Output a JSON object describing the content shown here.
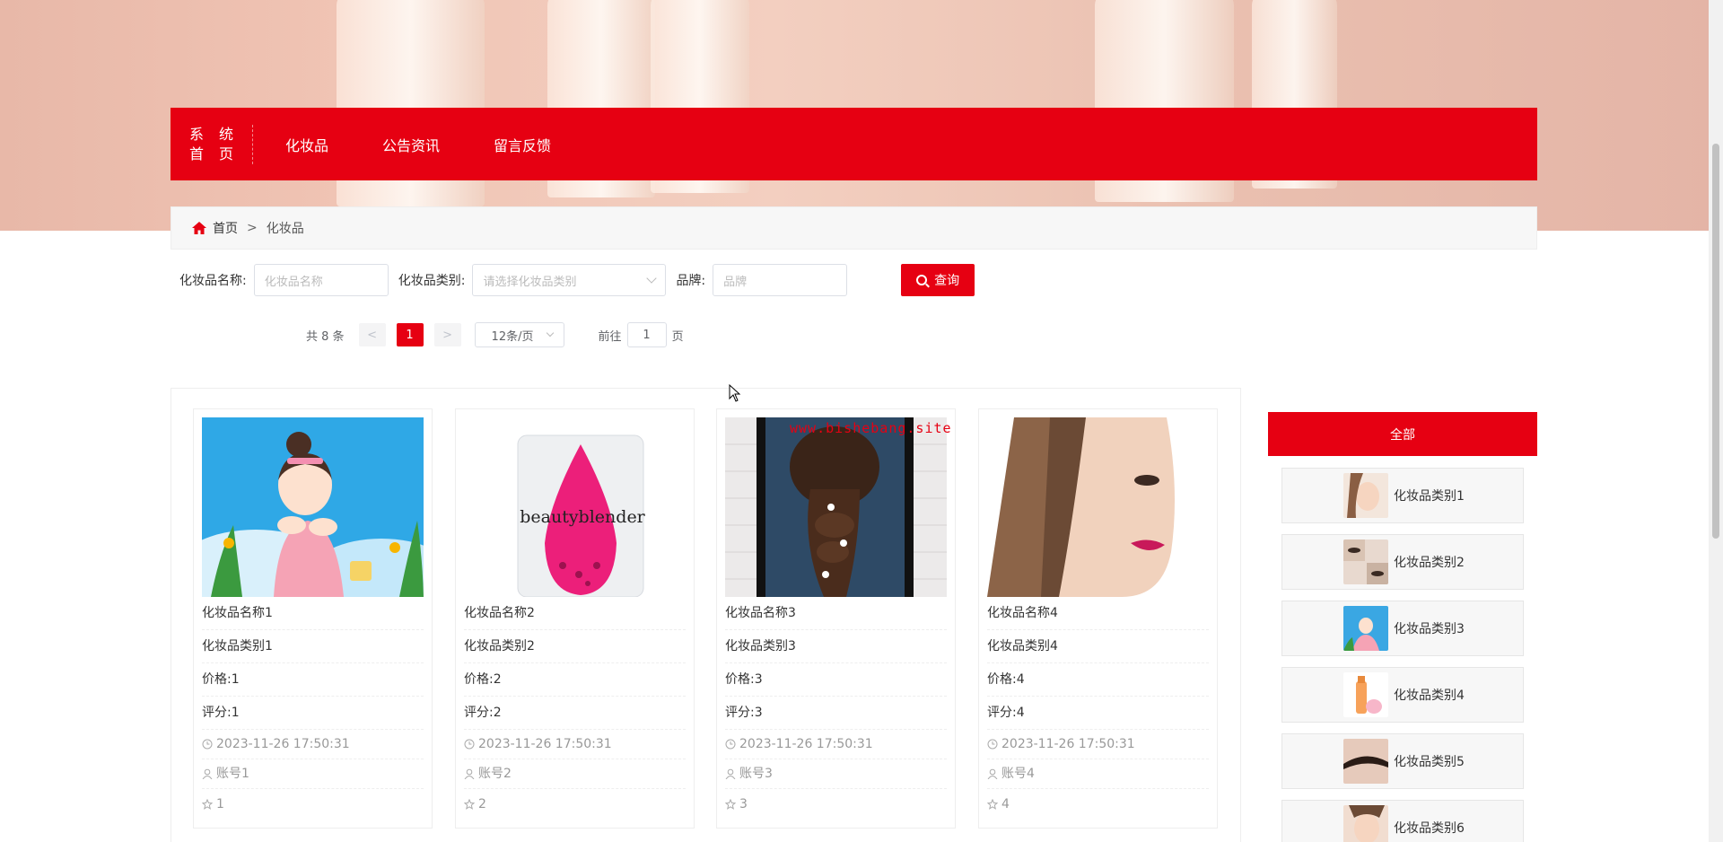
{
  "nav": {
    "home_line1": "系 统",
    "home_line2": "首 页",
    "items": [
      {
        "label": "化妆品"
      },
      {
        "label": "公告资讯"
      },
      {
        "label": "留言反馈"
      }
    ]
  },
  "breadcrumb": {
    "home": "首页",
    "sep": ">",
    "current": "化妆品"
  },
  "search": {
    "name_label": "化妆品名称:",
    "name_placeholder": "化妆品名称",
    "category_label": "化妆品类别:",
    "category_placeholder": "请选择化妆品类别",
    "brand_label": "品牌:",
    "brand_placeholder": "品牌",
    "query_button": "查询"
  },
  "pagination": {
    "total": "共 8 条",
    "prev": "<",
    "current": "1",
    "next": ">",
    "page_size": "12条/页",
    "goto_prefix": "前往",
    "goto_value": "1",
    "goto_suffix": "页"
  },
  "products": [
    {
      "name": "化妆品名称1",
      "category": "化妆品类别1",
      "price": "价格:1",
      "score": "评分:1",
      "time": "2023-11-26 17:50:31",
      "account": "账号1",
      "stars": "1"
    },
    {
      "name": "化妆品名称2",
      "category": "化妆品类别2",
      "price": "价格:2",
      "score": "评分:2",
      "time": "2023-11-26 17:50:31",
      "account": "账号2",
      "stars": "2"
    },
    {
      "name": "化妆品名称3",
      "category": "化妆品类别3",
      "price": "价格:3",
      "score": "评分:3",
      "time": "2023-11-26 17:50:31",
      "account": "账号3",
      "stars": "3"
    },
    {
      "name": "化妆品名称4",
      "category": "化妆品类别4",
      "price": "价格:4",
      "score": "评分:4",
      "time": "2023-11-26 17:50:31",
      "account": "账号4",
      "stars": "4"
    }
  ],
  "product2_image_text": "beautyblender",
  "watermark": "www.bishebang.site",
  "sidebar": {
    "all_label": "全部",
    "categories": [
      {
        "label": "化妆品类别1"
      },
      {
        "label": "化妆品类别2"
      },
      {
        "label": "化妆品类别3"
      },
      {
        "label": "化妆品类别4"
      },
      {
        "label": "化妆品类别5"
      },
      {
        "label": "化妆品类别6"
      }
    ]
  },
  "colors": {
    "accent": "#e60012",
    "border": "#eeeeee",
    "muted": "#999999"
  }
}
